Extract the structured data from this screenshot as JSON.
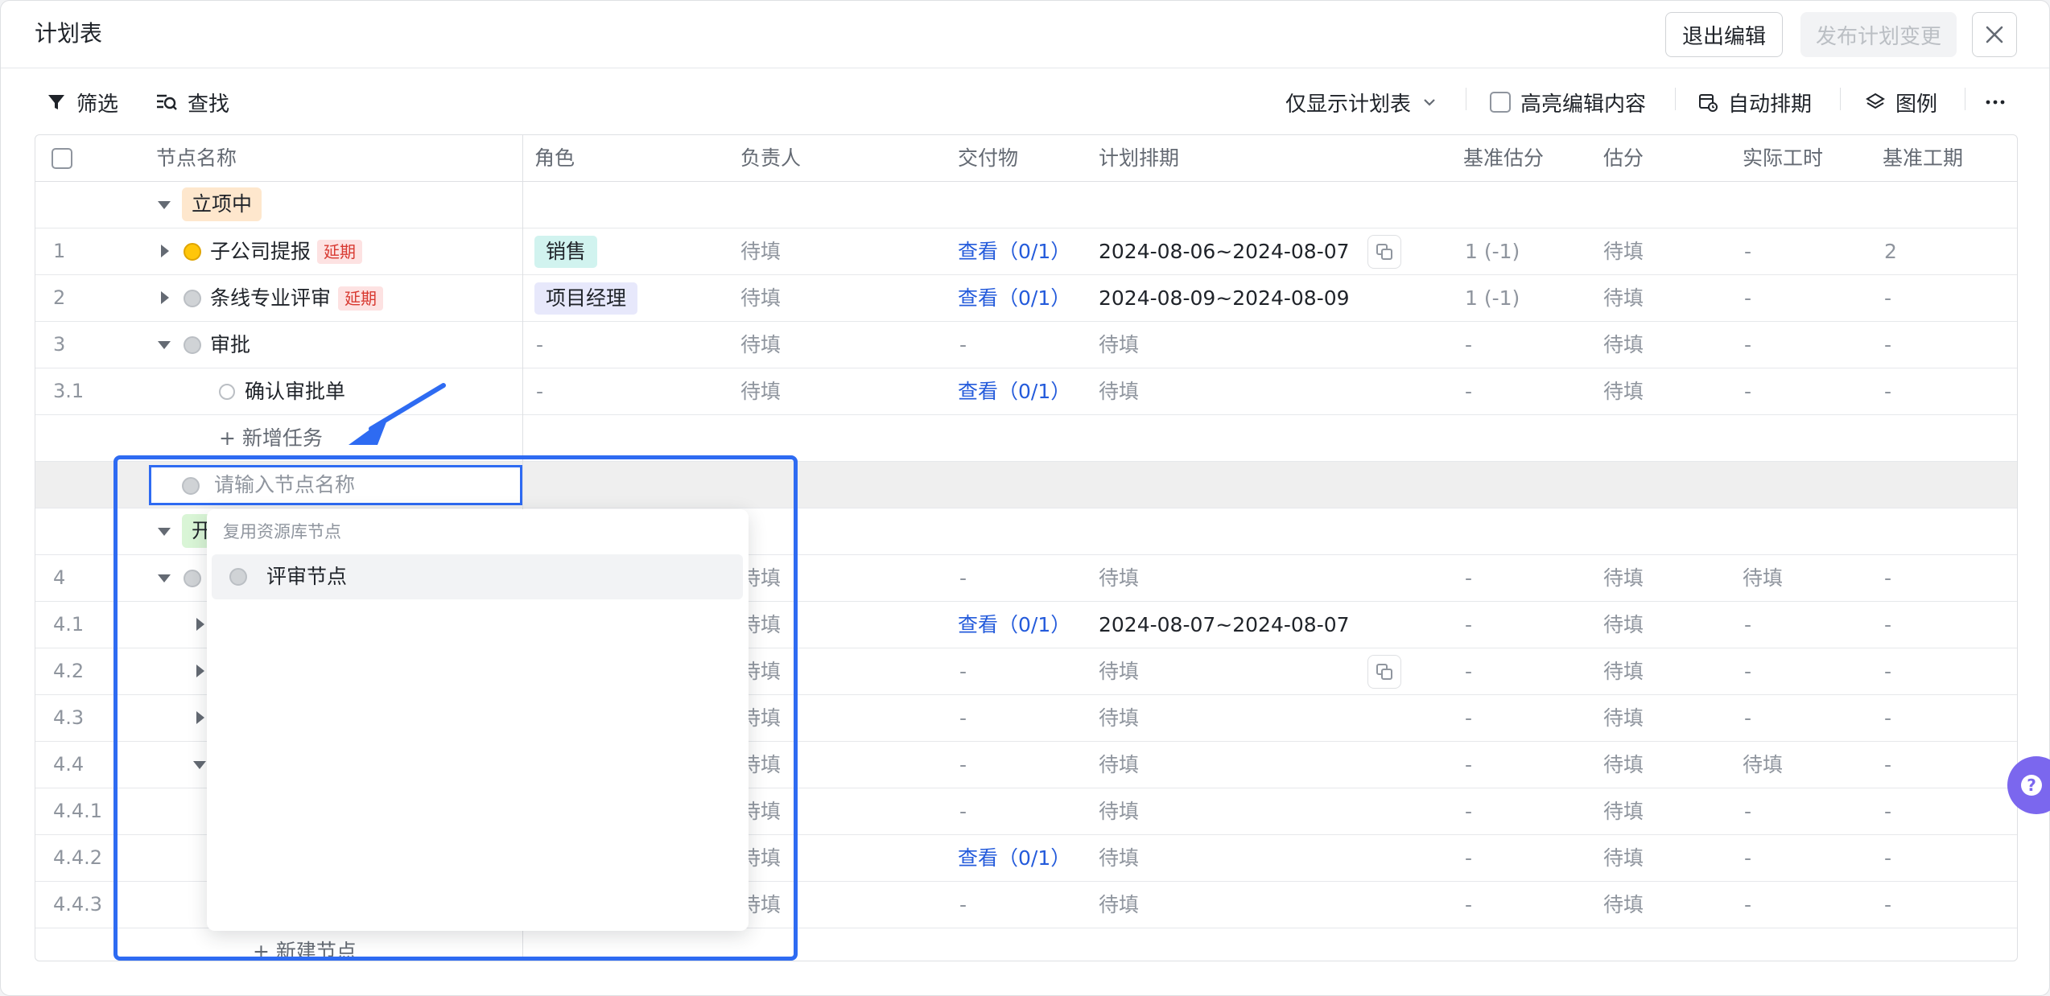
{
  "header": {
    "title": "计划表",
    "exit_label": "退出编辑",
    "publish_label": "发布计划变更"
  },
  "toolbar": {
    "filter_label": "筛选",
    "search_label": "查找",
    "view_select": "仅显示计划表",
    "highlight_label": "高亮编辑内容",
    "auto_schedule_label": "自动排期",
    "legend_label": "图例"
  },
  "columns": {
    "name": "节点名称",
    "role": "角色",
    "owner": "负责人",
    "deliverable": "交付物",
    "schedule": "计划排期",
    "base_estimate": "基准估分",
    "estimate": "估分",
    "actual_hours": "实际工时",
    "base_duration": "基准工期"
  },
  "rows": {
    "stage1": {
      "label": "立项中"
    },
    "r1": {
      "num": "1",
      "name": "子公司提报",
      "tag": "延期",
      "role": "销售",
      "owner": "待填",
      "deliverable": "查看（0/1）",
      "schedule": "2024-08-06~2024-08-07",
      "base_estimate": "1 (-1)",
      "estimate": "待填",
      "actual": "-",
      "duration": "2"
    },
    "r2": {
      "num": "2",
      "name": "条线专业评审",
      "tag": "延期",
      "role": "项目经理",
      "owner": "待填",
      "deliverable": "查看（0/1）",
      "schedule": "2024-08-09~2024-08-09",
      "base_estimate": "1 (-1)",
      "estimate": "待填",
      "actual": "-",
      "duration": "-"
    },
    "r3": {
      "num": "3",
      "name": "审批",
      "role": "-",
      "owner": "待填",
      "deliverable": "-",
      "schedule": "待填",
      "base_estimate": "-",
      "estimate": "待填",
      "actual": "-",
      "duration": "-"
    },
    "r31": {
      "num": "3.1",
      "name": "确认审批单",
      "role": "-",
      "owner": "待填",
      "deliverable": "查看（0/1）",
      "schedule": "待填",
      "base_estimate": "-",
      "estimate": "待填",
      "actual": "-",
      "duration": "-"
    },
    "add_task": {
      "label": "新增任务"
    },
    "new_node": {
      "placeholder": "请输入节点名称"
    },
    "stage2": {
      "label": "开"
    },
    "r4": {
      "num": "4",
      "owner": "待填",
      "deliverable": "-",
      "schedule": "待填",
      "base_estimate": "-",
      "estimate": "待填",
      "actual": "待填",
      "duration": "-"
    },
    "r41": {
      "num": "4.1",
      "owner": "待填",
      "deliverable": "查看（0/1）",
      "schedule": "2024-08-07~2024-08-07",
      "base_estimate": "-",
      "estimate": "待填",
      "actual": "-",
      "duration": "-"
    },
    "r42": {
      "num": "4.2",
      "owner": "待填",
      "deliverable": "-",
      "schedule": "待填",
      "base_estimate": "-",
      "estimate": "待填",
      "actual": "-",
      "duration": "-"
    },
    "r43": {
      "num": "4.3",
      "owner": "待填",
      "deliverable": "-",
      "schedule": "待填",
      "base_estimate": "-",
      "estimate": "待填",
      "actual": "-",
      "duration": "-"
    },
    "r44": {
      "num": "4.4",
      "owner": "待填",
      "deliverable": "-",
      "schedule": "待填",
      "base_estimate": "-",
      "estimate": "待填",
      "actual": "待填",
      "duration": "-"
    },
    "r441": {
      "num": "4.4.1",
      "owner": "待填",
      "deliverable": "-",
      "schedule": "待填",
      "base_estimate": "-",
      "estimate": "待填",
      "actual": "-",
      "duration": "-"
    },
    "r442": {
      "num": "4.4.2",
      "owner": "待填",
      "deliverable": "查看（0/1）",
      "schedule": "待填",
      "base_estimate": "-",
      "estimate": "待填",
      "actual": "-",
      "duration": "-"
    },
    "r443": {
      "num": "4.4.3",
      "owner": "待填",
      "deliverable": "-",
      "schedule": "待填",
      "base_estimate": "-",
      "estimate": "待填",
      "actual": "-",
      "duration": "-"
    },
    "add_node": {
      "label": "新建节点"
    }
  },
  "dropdown": {
    "section_title": "复用资源库节点",
    "item_label": "评审节点"
  },
  "icons": {
    "filter": "filter-icon",
    "search": "search-icon",
    "chevron": "chevron-down-icon",
    "auto_schedule": "calendar-clock-icon",
    "legend": "layers-icon",
    "more": "more-icon",
    "close": "close-icon",
    "help": "help-icon",
    "copy": "copy-icon"
  },
  "colors": {
    "link": "#245bdb",
    "highlight": "#2e6bf2",
    "delay_tag_bg": "#fde2e2",
    "delay_tag_text": "#d83931",
    "stage_orange": "#fee7cd",
    "stage_green": "#d9f5d6",
    "role_teal": "#d1f3ef",
    "role_purple": "#e7e8fb",
    "help_purple": "#7b67ee"
  }
}
